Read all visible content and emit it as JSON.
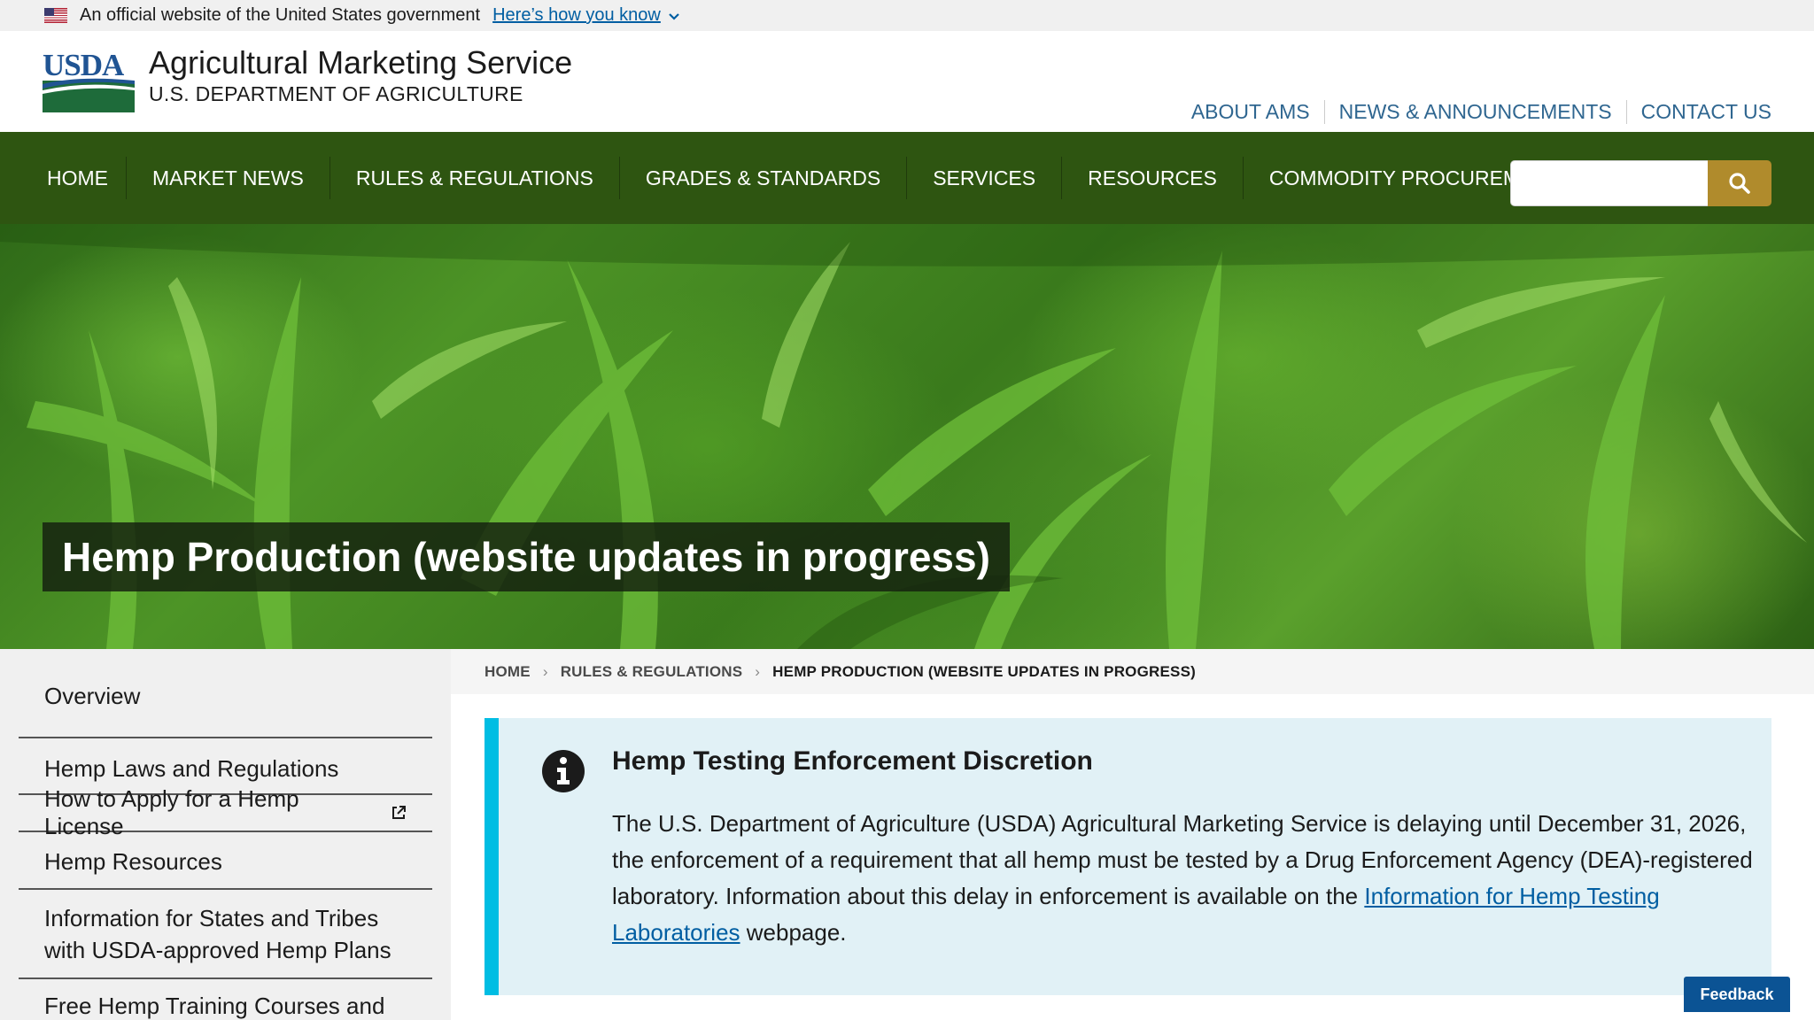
{
  "gov_banner": {
    "text": "An official website of the United States government",
    "link": "Here’s how you know"
  },
  "header": {
    "logo_text": "USDA",
    "title": "Agricultural Marketing Service",
    "subtitle": "U.S. DEPARTMENT OF AGRICULTURE",
    "utility_links": [
      "ABOUT AMS",
      "NEWS & ANNOUNCEMENTS",
      "CONTACT US"
    ]
  },
  "nav": {
    "items": [
      "HOME",
      "MARKET NEWS",
      "RULES & REGULATIONS",
      "GRADES & STANDARDS",
      "SERVICES",
      "RESOURCES",
      "COMMODITY PROCUREMENT"
    ],
    "search_value": "",
    "search_icon": "search-icon"
  },
  "hero": {
    "title": "Hemp Production (website updates in progress)"
  },
  "sidebar": {
    "items": [
      {
        "label": "Overview"
      },
      {
        "label": "Hemp Laws and Regulations"
      },
      {
        "label": "How to Apply for a Hemp License",
        "external": true
      },
      {
        "label": "Hemp Resources"
      },
      {
        "label": "Information for States and Tribes with USDA-approved Hemp Plans"
      },
      {
        "label": "Free Hemp Training Courses and"
      }
    ]
  },
  "breadcrumb": {
    "home": "HOME",
    "section": "RULES & REGULATIONS",
    "current": "HEMP PRODUCTION (WEBSITE UPDATES IN PROGRESS)"
  },
  "alert": {
    "icon": "info-icon",
    "heading": "Hemp Testing Enforcement Discretion",
    "body_before": "The U.S. Department of Agriculture (USDA) Agricultural Marketing Service is delaying until December 31, 2026, the enforcement of a requirement that all hemp must be tested by a Drug Enforcement Agency (DEA)-registered laboratory. Information about this delay in enforcement is available on the ",
    "link": "Information for Hemp Testing Laboratories",
    "body_after": " webpage."
  },
  "feedback": "Feedback",
  "colors": {
    "nav_green": "#2e5511",
    "search_gold": "#b08b2c",
    "alert_bg": "#e1f1f6",
    "alert_border": "#00bde3",
    "link_blue": "#005ea2",
    "feedback_blue": "#0b5394"
  }
}
